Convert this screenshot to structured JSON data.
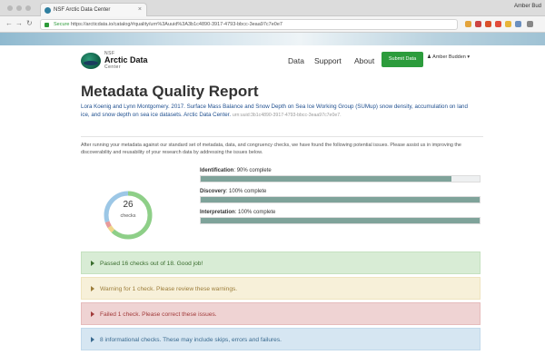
{
  "browser": {
    "tab_title": "NSF Arctic Data Center",
    "tab_close": "×",
    "user": "Amber Bud",
    "url_secure": "Secure",
    "url": "https://arcticdata.io/catalog/#quality/urn%3Auuid%3A3b1c4890-3917-4793-bbcc-3eaa97c7e0e7"
  },
  "header": {
    "logo_line1": "NSF",
    "logo_line2": "Arctic Data",
    "logo_line3": "Center",
    "nav": [
      "Data",
      "Support",
      "About"
    ],
    "submit_label": "Submit Data",
    "user_label": "Amber Budden"
  },
  "report": {
    "title": "Metadata Quality Report",
    "citation": "Lora Koenig and Lynn Montgomery. 2017. Surface Mass Balance and Snow Depth on Sea Ice Working Group (SUMup) snow density, accumulation on land ice, and snow depth on sea ice datasets. Arctic Data Center.",
    "pid": "urn:uuid:3b1c4890-3917-4793-bbcc-3eaa97c7e0e7.",
    "intro": "After running your metadata against our standard set of metadata, data, and congruency checks, we have found the following potential issues. Please assist us in improving the discoverability and reusability of your research data by addressing the issues below."
  },
  "summary": {
    "check_count": "26",
    "check_label": "checks",
    "gauge_segments": [
      {
        "fraction": 0.62,
        "color": "#8ecf88"
      },
      {
        "fraction": 0.04,
        "color": "#f0d68a"
      },
      {
        "fraction": 0.04,
        "color": "#e89a9a"
      },
      {
        "fraction": 0.3,
        "color": "#9cc7e6"
      }
    ]
  },
  "progress": [
    {
      "name": "Identification",
      "suffix": "90% complete",
      "percent": 90
    },
    {
      "name": "Discovery",
      "suffix": "100% complete",
      "percent": 100
    },
    {
      "name": "Interpretation",
      "suffix": "100% complete",
      "percent": 100
    }
  ],
  "panels": {
    "success": "Passed 16 checks out of 18. Good job!",
    "warning": "Warning for 1 check. Please review these warnings.",
    "failure": "Failed 1 check. Please correct these issues.",
    "info": "8 informational checks. These may include skips, errors and failures."
  },
  "colors": {
    "accent": "#2c9c3c",
    "link": "#1f4f8f",
    "bar_fill": "#7fa39a"
  }
}
